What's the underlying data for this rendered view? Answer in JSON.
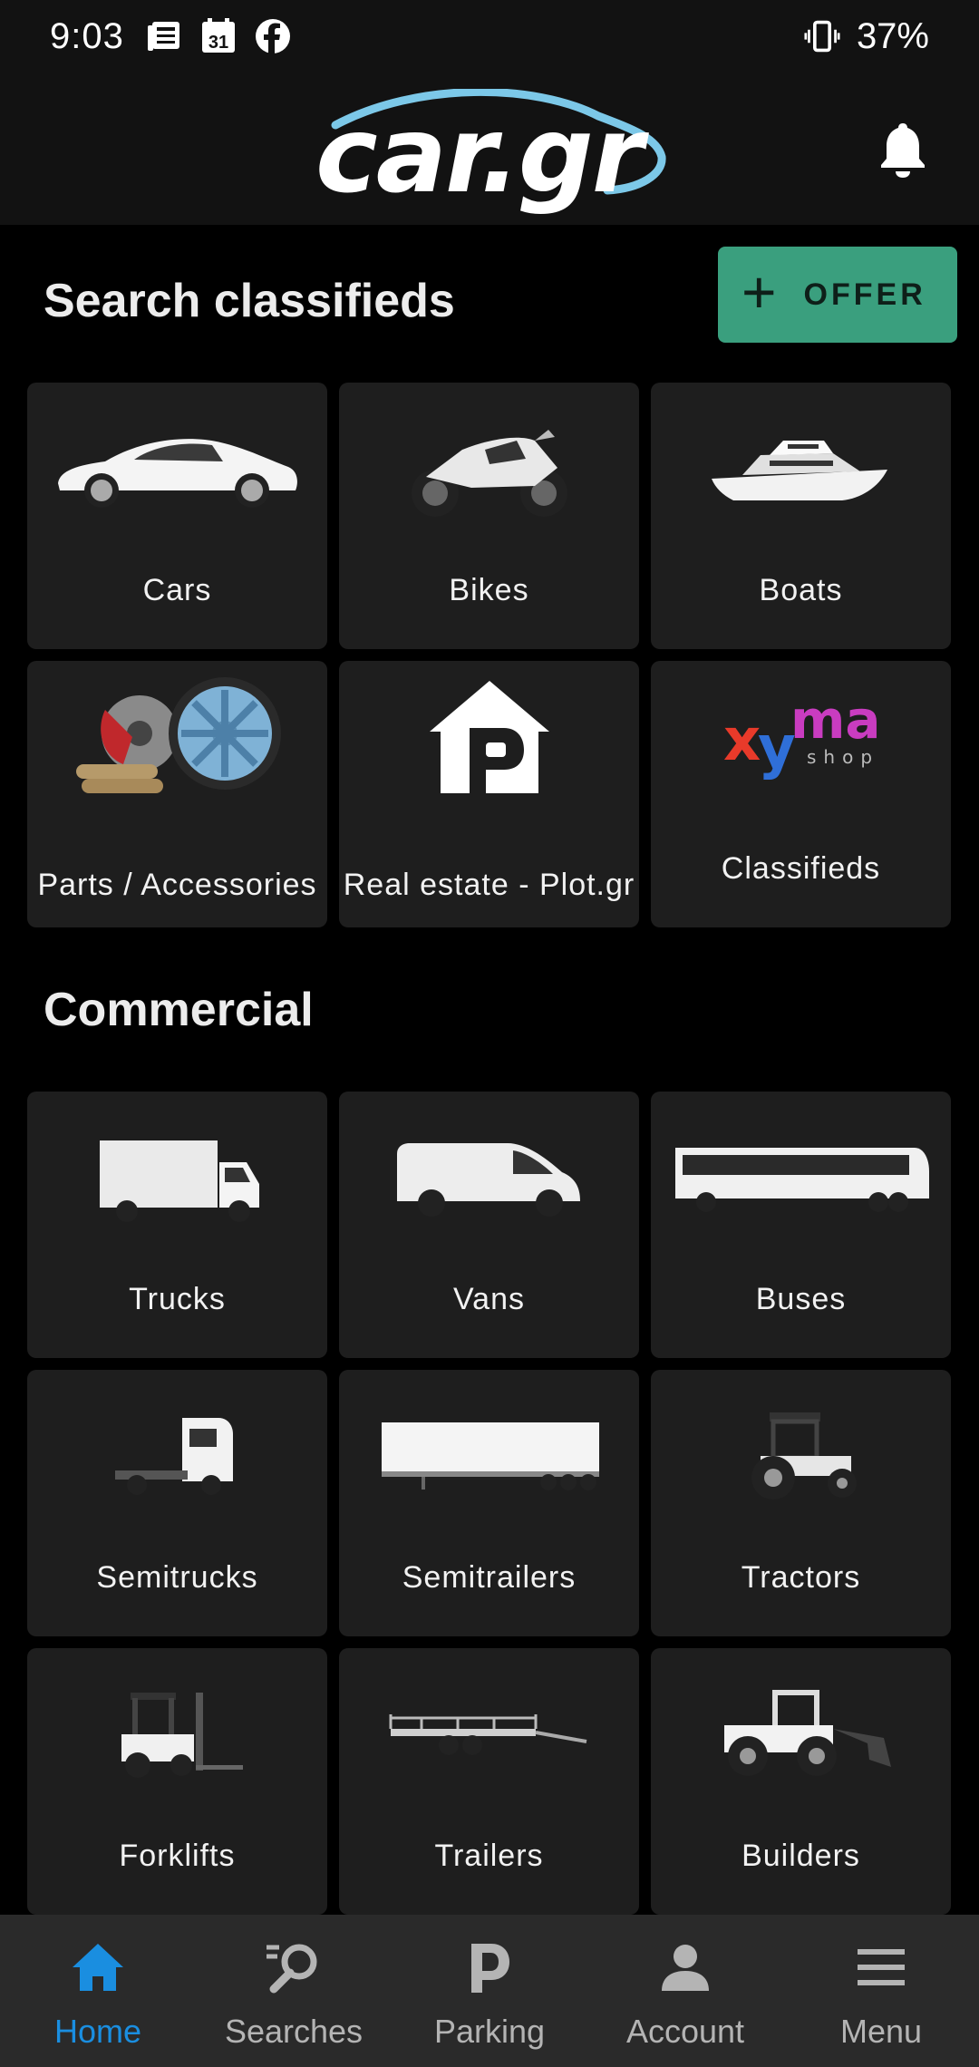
{
  "status_bar": {
    "time": "9:03",
    "calendar_day": "31",
    "battery": "37%",
    "icons": [
      "news-icon",
      "calendar-icon",
      "facebook-icon",
      "vibrate-icon"
    ]
  },
  "app_bar": {
    "logo": "car.gr",
    "notifications_icon": "bell-icon"
  },
  "search": {
    "title": "Search classifieds",
    "offer_label": "OFFER",
    "tiles": [
      {
        "label": "Cars",
        "image": "car"
      },
      {
        "label": "Bikes",
        "image": "motorbike"
      },
      {
        "label": "Boats",
        "image": "yacht"
      },
      {
        "label": "Parts / Accessories",
        "image": "parts"
      },
      {
        "label": "Real estate - Plot.gr",
        "image": "house-logo"
      },
      {
        "label": "Classifieds",
        "image": "xyma-logo"
      }
    ],
    "xyma_logo": {
      "x": "x",
      "y": "y",
      "ma": "ma",
      "sub": "shop"
    }
  },
  "commercial": {
    "title": "Commercial",
    "tiles": [
      {
        "label": "Trucks",
        "image": "box-truck"
      },
      {
        "label": "Vans",
        "image": "van"
      },
      {
        "label": "Buses",
        "image": "bus"
      },
      {
        "label": "Semitrucks",
        "image": "tractor-unit"
      },
      {
        "label": "Semitrailers",
        "image": "semitrailer"
      },
      {
        "label": "Tractors",
        "image": "farm-tractor"
      },
      {
        "label": "Forklifts",
        "image": "forklift"
      },
      {
        "label": "Trailers",
        "image": "trailer"
      },
      {
        "label": "Builders",
        "image": "wheel-loader"
      }
    ]
  },
  "bottom_nav": {
    "active": "Home",
    "items": [
      {
        "label": "Home",
        "icon": "home-icon"
      },
      {
        "label": "Searches",
        "icon": "search-icon"
      },
      {
        "label": "Parking",
        "icon": "parking-icon"
      },
      {
        "label": "Account",
        "icon": "account-icon"
      },
      {
        "label": "Menu",
        "icon": "menu-icon"
      }
    ]
  },
  "colors": {
    "offer_button": "#3a9f7e",
    "tile_bg": "#1e1e1e",
    "nav_active": "#1a8ee0",
    "logo_swoosh": "#7cc8e8"
  }
}
